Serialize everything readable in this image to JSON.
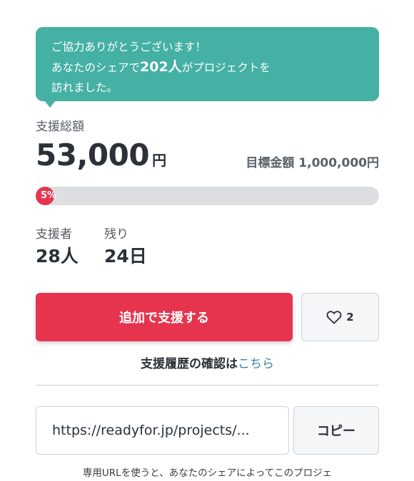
{
  "bubble": {
    "line1": "ご協力ありがとうございます！",
    "line2_pre": "あなたのシェアで",
    "line2_count": "202人",
    "line2_post": "がプロジェクトを",
    "line3": "訪れました。"
  },
  "funding": {
    "total_label": "支援総額",
    "total_amount": "53,000",
    "currency": "円",
    "goal_label": "目標金額",
    "goal_amount": "1,000,000円",
    "percent_text": "5%",
    "percent_value": 5
  },
  "stats": {
    "backers_label": "支援者",
    "backers_value": "28人",
    "remaining_label": "残り",
    "remaining_value": "24日"
  },
  "actions": {
    "support_button": "追加で支援する",
    "like_count": "2"
  },
  "history": {
    "text": "支援履歴の確認は",
    "link": "こちら"
  },
  "share": {
    "url": "https://readyfor.jp/projects/...",
    "copy_button": "コピー",
    "note": "専用URLを使うと、あなたのシェアによってこのプロジェ"
  },
  "colors": {
    "bubble": "#45b0a4",
    "accent": "#e6344f",
    "link": "#3b7fa0"
  }
}
